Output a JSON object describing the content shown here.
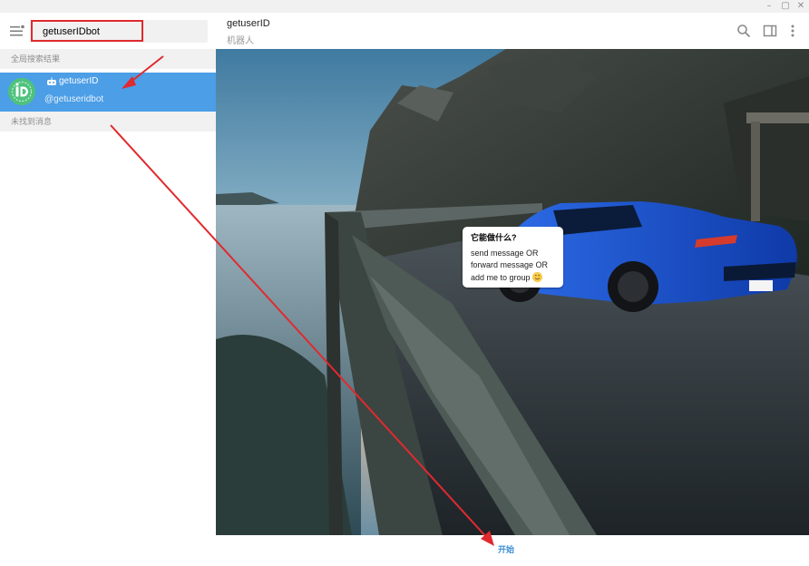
{
  "search": {
    "value": "getuserIDbot",
    "placeholder": ""
  },
  "sections": {
    "global_results": "全局搜索结果",
    "messages_not_found": "未找到消息"
  },
  "result": {
    "name": "getuserID",
    "username": "@getuseridbot"
  },
  "chat": {
    "title": "getuserID",
    "subtitle": "机器人"
  },
  "bubble": {
    "title": "它能做什么?",
    "line1": "send message  OR",
    "line2": "forward message  OR",
    "line3": "add me to group"
  },
  "start_button": "开始",
  "icons": {
    "menu": "menu-icon",
    "clear": "close-icon",
    "bot": "bot-icon",
    "search": "search-icon",
    "sidebar": "sidebar-toggle-icon",
    "more": "more-vertical-icon",
    "emoji": "smile-emoji-icon"
  },
  "colors": {
    "accent": "#4c9ee6",
    "annotation": "#e02a2f",
    "avatar": "#4ec27d",
    "car": "#1a4fc9"
  }
}
